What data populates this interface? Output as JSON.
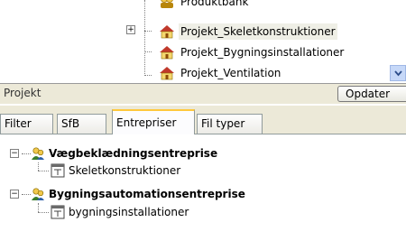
{
  "upper_tree": {
    "items": [
      {
        "label": "Produktbank"
      },
      {
        "label": "Projekt_Skeletkonstruktioner"
      },
      {
        "label": "Projekt_Bygningsinstallationer"
      },
      {
        "label": "Projekt_Ventilation"
      }
    ],
    "expand_glyph": "+"
  },
  "panel": {
    "title": "Projekt",
    "update_button": "Opdater"
  },
  "tabs": [
    {
      "label": "Filter"
    },
    {
      "label": "SfB"
    },
    {
      "label": "Entrepriser"
    },
    {
      "label": "Fil typer"
    }
  ],
  "active_tab": "Entrepriser",
  "tree": [
    {
      "label": "Vægbeklædningsentreprise",
      "child": "Skeletkonstruktioner"
    },
    {
      "label": "Bygningsautomationsentreprise",
      "child": "bygningsinstallationer"
    }
  ],
  "collapse_glyph": "−",
  "colors": {
    "accent_tab": "#ffc83c",
    "panel_bg": "#ece9d8",
    "house_roof": "#c0392b"
  },
  "icons": [
    "project-house-icon",
    "group-icon",
    "user-group-icon",
    "form-icon",
    "scroll-down-icon"
  ]
}
